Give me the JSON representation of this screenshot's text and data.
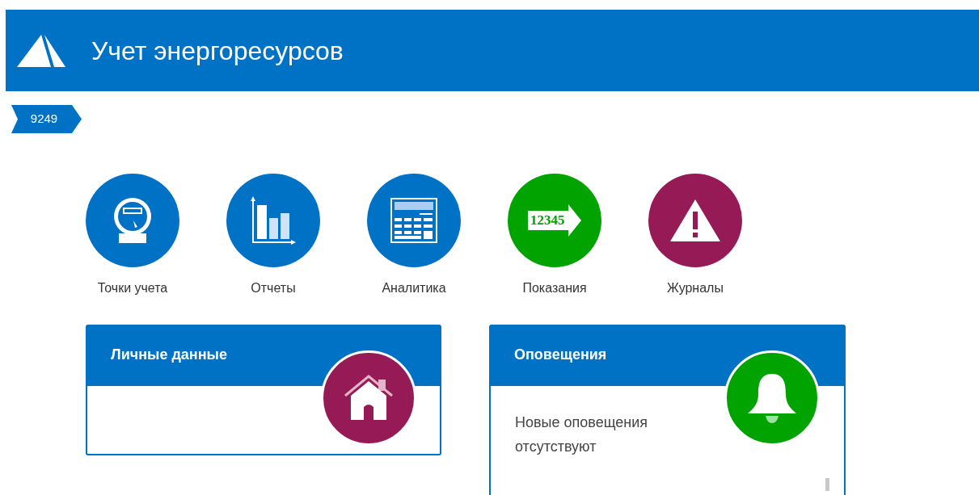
{
  "header": {
    "title": "Учет энергоресурсов"
  },
  "breadcrumb": {
    "label": "9249"
  },
  "tiles": [
    {
      "label": "Точки учета",
      "kind": "meter",
      "color": "#0072c6"
    },
    {
      "label": "Отчеты",
      "kind": "chart",
      "color": "#0072c6"
    },
    {
      "label": "Аналитика",
      "kind": "calculator",
      "color": "#0072c6"
    },
    {
      "label": "Показания",
      "kind": "readings",
      "color": "#00a300",
      "icon_text": "12345"
    },
    {
      "label": "Журналы",
      "kind": "warning",
      "color": "#961a56"
    }
  ],
  "cards": [
    {
      "title": "Личные данные",
      "kind": "home",
      "color": "#961a56"
    },
    {
      "title": "Оповещения",
      "kind": "bell",
      "color": "#00a300",
      "text": "Новые оповещения отсутствуют"
    }
  ]
}
